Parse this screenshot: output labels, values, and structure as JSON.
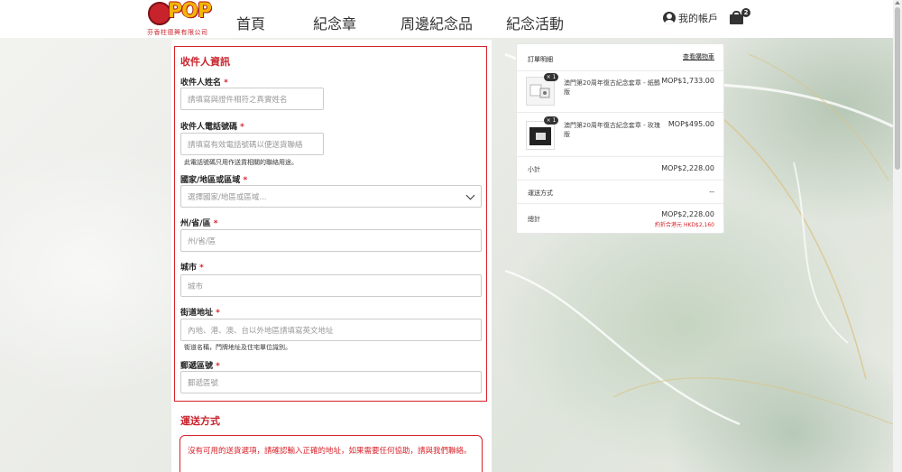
{
  "header": {
    "logo_text": "POP",
    "logo_subtitle": "芬香柱德興有限公司",
    "nav": [
      "首頁",
      "紀念章",
      "周邊紀念品",
      "紀念活動"
    ],
    "account_label": "我的帳戶",
    "cart_count": "2"
  },
  "form": {
    "section_title": "收件人資訊",
    "name_label": "收件人姓名",
    "name_placeholder": "請填寫與證件相符之真實姓名",
    "phone_label": "收件人電話號碼",
    "phone_placeholder": "請填寫有效電話號碼以便送貨聯絡",
    "phone_hint": "此電話號碼只用作送貨相關的聯絡用途。",
    "country_label": "國家/地區或區域",
    "country_placeholder": "選擇國家/地區或區域...",
    "state_label": "州/省/區",
    "state_placeholder": "州/省/區",
    "city_label": "城市",
    "city_placeholder": "城市",
    "street_label": "街道地址",
    "street_placeholder": "內地、港、澳、台以外地區請填寫英文地址",
    "street_hint": "街道名稱，門牌地址及住宅單位識別。",
    "postal_label": "郵遞區號",
    "postal_placeholder": "郵遞區號",
    "required_mark": "*"
  },
  "shipping": {
    "title": "運送方式",
    "alert": "沒有可用的送貨選項，請確認輸入正確的地址，如果需要任何協助，請與我們聯絡。"
  },
  "summary": {
    "title": "訂單明細",
    "edit_link": "查看購物車",
    "items": [
      {
        "qty": "× 1",
        "name": "澳門第20周年復古紀念套章 - 紙鶴版",
        "price": "MOP$1,733.00"
      },
      {
        "qty": "× 1",
        "name": "澳門第20周年復古紀念套章 - 玫瑰版",
        "price": "MOP$495.00"
      }
    ],
    "subtotal_label": "小計",
    "subtotal_value": "MOP$2,228.00",
    "shipping_label": "運送方式",
    "shipping_value": "--",
    "total_label": "總計",
    "total_value": "MOP$2,228.00",
    "total_note": "約折合港元 HKD$2,160"
  },
  "colors": {
    "accent": "#c8232c",
    "border_red": "#d8222a"
  }
}
